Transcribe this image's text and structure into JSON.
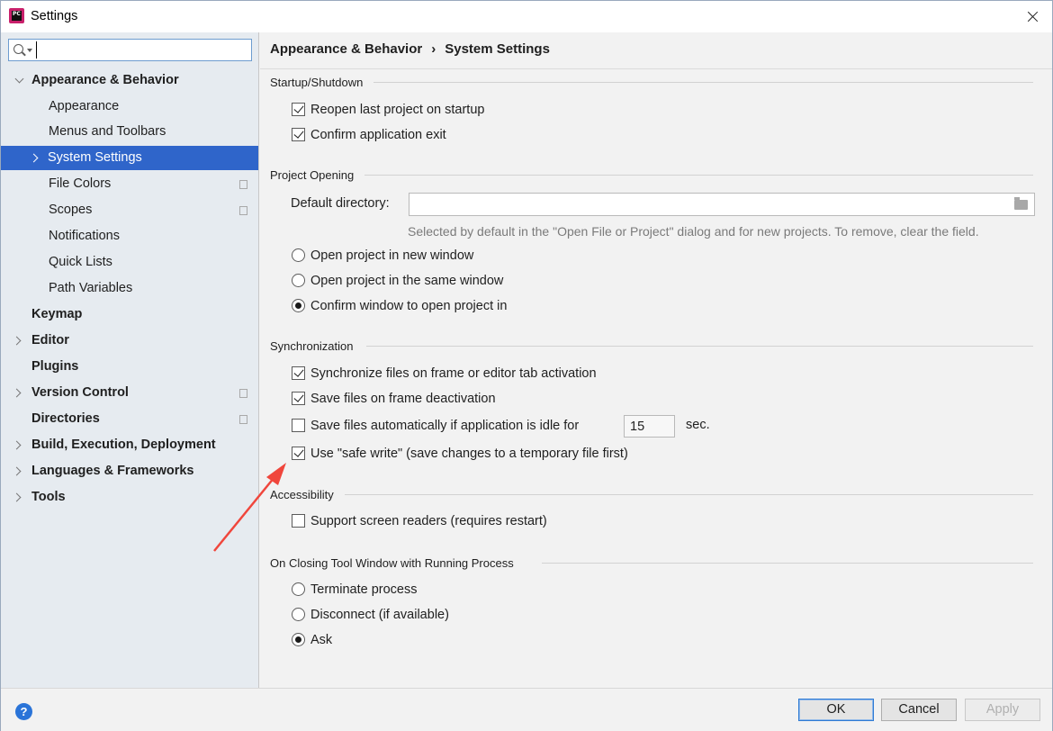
{
  "window": {
    "title": "Settings"
  },
  "search": {
    "value": ""
  },
  "sidebar": {
    "items": [
      {
        "label": "Appearance & Behavior",
        "bold": true,
        "expanded": true
      },
      {
        "label": "Appearance"
      },
      {
        "label": "Menus and Toolbars"
      },
      {
        "label": "System Settings",
        "selected": true
      },
      {
        "label": "File Colors"
      },
      {
        "label": "Scopes"
      },
      {
        "label": "Notifications"
      },
      {
        "label": "Quick Lists"
      },
      {
        "label": "Path Variables"
      },
      {
        "label": "Keymap",
        "bold": true
      },
      {
        "label": "Editor",
        "bold": true
      },
      {
        "label": "Plugins",
        "bold": true
      },
      {
        "label": "Version Control",
        "bold": true
      },
      {
        "label": "Directories",
        "bold": true
      },
      {
        "label": "Build, Execution, Deployment",
        "bold": true
      },
      {
        "label": "Languages & Frameworks",
        "bold": true
      },
      {
        "label": "Tools",
        "bold": true
      }
    ]
  },
  "breadcrumb": {
    "parent": "Appearance & Behavior",
    "separator": "›",
    "current": "System Settings"
  },
  "startup": {
    "header": "Startup/Shutdown",
    "reopen": {
      "label": "Reopen last project on startup",
      "checked": true
    },
    "confirm_exit": {
      "label": "Confirm application exit",
      "checked": true
    }
  },
  "project_opening": {
    "header": "Project Opening",
    "default_dir_label": "Default directory:",
    "default_dir_value": "",
    "hint": "Selected by default in the \"Open File or Project\" dialog and for new projects. To remove, clear the field.",
    "options": [
      {
        "label": "Open project in new window",
        "selected": false
      },
      {
        "label": "Open project in the same window",
        "selected": false
      },
      {
        "label": "Confirm window to open project in",
        "selected": true
      }
    ]
  },
  "sync": {
    "header": "Synchronization",
    "sync_files": {
      "label": "Synchronize files on frame or editor tab activation",
      "checked": true
    },
    "save_deactivation": {
      "label": "Save files on frame deactivation",
      "checked": true
    },
    "save_idle": {
      "label": "Save files automatically if application is idle for",
      "checked": false
    },
    "idle_value": "15",
    "idle_unit": "sec.",
    "safe_write": {
      "label": "Use \"safe write\" (save changes to a temporary file first)",
      "checked": true
    }
  },
  "accessibility": {
    "header": "Accessibility",
    "screen_readers": {
      "label": "Support screen readers (requires restart)",
      "checked": false
    }
  },
  "closing": {
    "header": "On Closing Tool Window with Running Process",
    "options": [
      {
        "label": "Terminate process",
        "selected": false
      },
      {
        "label": "Disconnect (if available)",
        "selected": false
      },
      {
        "label": "Ask",
        "selected": true
      }
    ]
  },
  "buttons": {
    "help": "?",
    "ok": "OK",
    "cancel": "Cancel",
    "apply": "Apply"
  },
  "colors": {
    "selection": "#2f65ca",
    "annotation_arrow": "#f0463c",
    "help": "#2a74d8"
  }
}
